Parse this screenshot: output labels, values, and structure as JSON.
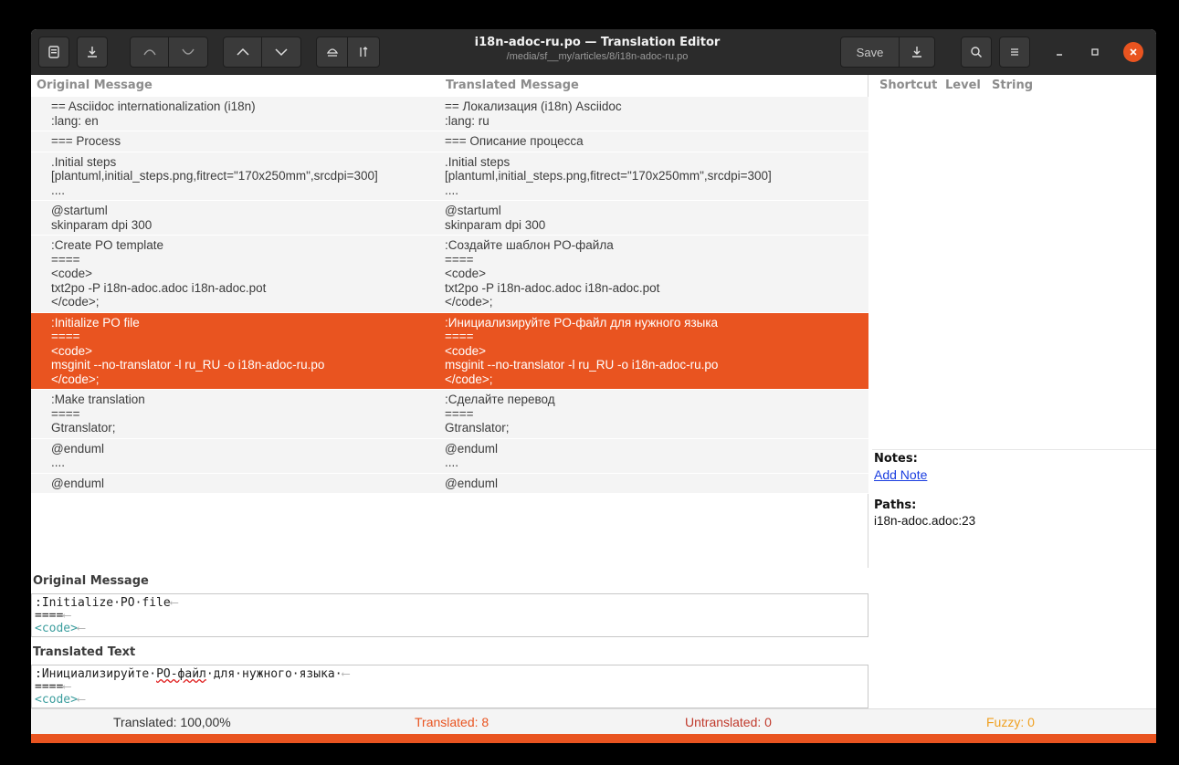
{
  "window": {
    "title": "i18n-adoc-ru.po — Translation Editor",
    "subtitle": "/media/sf__my/articles/8/i18n-adoc-ru.po",
    "save_label": "Save"
  },
  "colors": {
    "accent": "#e95420",
    "headerbar": "#2b2b2b",
    "translated_count": "#e95420",
    "untranslated_count": "#c0392b",
    "fuzzy_count": "#f0a020"
  },
  "icons": {
    "open": "document-icon",
    "save_down": "download-arrow-icon",
    "undo": "undo-arc-icon",
    "redo": "redo-arc-icon",
    "prev": "chevron-up-icon",
    "next": "chevron-down-icon",
    "pin": "eject-icon",
    "sort": "sort-icon",
    "search": "search-icon",
    "menu": "hamburger-menu-icon",
    "minimize": "minimize-icon",
    "maximize": "maximize-icon",
    "close": "close-icon"
  },
  "list": {
    "col_original": "Original Message",
    "col_translated": "Translated Message",
    "rows": [
      {
        "original": "== Asciidoc internationalization (i18n)\n:lang: en",
        "translated": "== Локализация (i18n) Asciidoc\n:lang: ru"
      },
      {
        "original": "=== Process",
        "translated": "=== Описание процесса"
      },
      {
        "original": ".Initial steps\n[plantuml,initial_steps.png,fitrect=\"170x250mm\",srcdpi=300]\n....",
        "translated": ".Initial steps\n[plantuml,initial_steps.png,fitrect=\"170x250mm\",srcdpi=300]\n...."
      },
      {
        "original": "@startuml\nskinparam dpi 300",
        "translated": "@startuml\nskinparam dpi 300"
      },
      {
        "original": ":Create PO template\n====\n<code>\ntxt2po -P i18n-adoc.adoc i18n-adoc.pot\n</code>;",
        "translated": ":Создайте шаблон PO-файла\n====\n<code>\ntxt2po -P i18n-adoc.adoc i18n-adoc.pot\n</code>;"
      },
      {
        "original": ":Initialize PO file\n====\n<code>\nmsginit --no-translator -l ru_RU -o i18n-adoc-ru.po\n</code>;",
        "translated": ":Инициализируйте PO-файл для нужного языка\n====\n<code>\nmsginit --no-translator -l ru_RU -o i18n-adoc-ru.po\n</code>;"
      },
      {
        "original": ":Make translation\n====\nGtranslator;",
        "translated": ":Сделайте перевод\n====\nGtranslator;"
      },
      {
        "original": "@enduml\n....",
        "translated": "@enduml\n...."
      },
      {
        "original": "@enduml",
        "translated": "@enduml"
      }
    ]
  },
  "side": {
    "col_shortcut": "Shortcut",
    "col_level": "Level",
    "col_string": "String",
    "notes_title": "Notes:",
    "add_note": "Add Note",
    "paths_title": "Paths:",
    "path_value": "i18n-adoc.adoc:23"
  },
  "editors": {
    "original_label": "Original Message",
    "original_line1": ":Initialize·PO·file",
    "original_line2": "====",
    "original_line3": "<code>",
    "translated_label": "Translated Text",
    "translated_line1_a": ":Инициализируйте·",
    "translated_line1_b": "PO-файл",
    "translated_line1_c": "·для·нужного·языка·",
    "translated_line2": "====",
    "translated_line3": "<code>"
  },
  "status": {
    "translated_pct": "Translated: 100,00%",
    "translated_count": "Translated: 8",
    "untranslated": "Untranslated: 0",
    "fuzzy": "Fuzzy: 0"
  }
}
